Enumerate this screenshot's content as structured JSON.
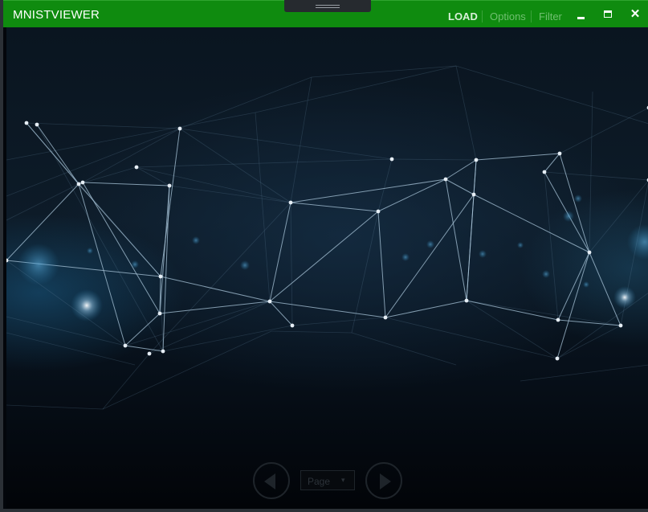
{
  "window": {
    "title": "MNISTVIEWER",
    "accent_color": "#0f8b0f"
  },
  "menu": {
    "load_label": "LOAD",
    "options_label": "Options",
    "filter_label": "Filter"
  },
  "window_controls": {
    "minimize_icon": "minimize-icon",
    "maximize_icon": "maximize-icon",
    "close_icon": "close-icon",
    "close_glyph": "✕"
  },
  "pager": {
    "prev_icon": "chevron-left-icon",
    "next_icon": "chevron-right-icon",
    "page_placeholder": "Page",
    "caret_glyph": "▾"
  },
  "background": {
    "image": "network-graph-background",
    "colors": {
      "lines": "#8fb3cc",
      "nodes": "#dfe9f2",
      "glow": "#2a7fb0"
    }
  }
}
